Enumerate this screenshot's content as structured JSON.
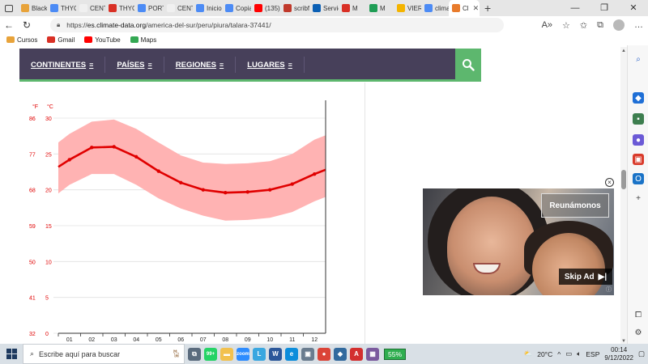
{
  "browser": {
    "tabs": [
      {
        "label": "Blackb",
        "color": "#e8a33a"
      },
      {
        "label": "THYCI",
        "color": "#4c8bf5"
      },
      {
        "label": "CENTF",
        "color": "#f0f0f0"
      },
      {
        "label": "THYC",
        "color": "#d93025"
      },
      {
        "label": "PORTA",
        "color": "#4c8bf5"
      },
      {
        "label": "CENTI",
        "color": "#f0f0f0"
      },
      {
        "label": "Inicio",
        "color": "#4c8bf5"
      },
      {
        "label": "Copia",
        "color": "#4c8bf5"
      },
      {
        "label": "(135) L",
        "color": "#ff0000"
      },
      {
        "label": "scribf",
        "color": "#c0392b"
      },
      {
        "label": "Servic",
        "color": "#0a5fb4"
      },
      {
        "label": "M",
        "color": "#d93025"
      },
      {
        "label": "M",
        "color": "#1f9d55"
      },
      {
        "label": "VIERN",
        "color": "#f4b400"
      },
      {
        "label": "clima",
        "color": "#4c8bf5"
      },
      {
        "label": "Cl",
        "color": "#e87b2c",
        "active": true
      }
    ],
    "new_tab": "+",
    "url_host": "es.climate-data.org",
    "url_path": "/america-del-sur/peru/piura/talara-37441/",
    "url_scheme": "https://",
    "bookmarks": [
      {
        "label": "Cursos",
        "color": "#e8a33a"
      },
      {
        "label": "Gmail",
        "color": "#d93025"
      },
      {
        "label": "YouTube",
        "color": "#ff0000"
      },
      {
        "label": "Maps",
        "color": "#34a853"
      }
    ]
  },
  "site_nav": {
    "items": [
      "CONTINENTES",
      "PAÍSES",
      "REGIONES",
      "LUGARES"
    ],
    "burger": "≡"
  },
  "chart_data": {
    "type": "line",
    "x": [
      "01",
      "02",
      "03",
      "04",
      "05",
      "06",
      "07",
      "08",
      "09",
      "10",
      "11",
      "12"
    ],
    "series": [
      {
        "values": [
          24.2,
          25.9,
          26.0,
          24.6,
          22.6,
          21.0,
          20.0,
          19.6,
          19.7,
          20.0,
          20.8,
          22.2
        ]
      }
    ],
    "band_upper": [
      27.8,
      29.5,
      29.8,
      28.5,
      26.6,
      24.8,
      23.8,
      23.6,
      23.7,
      24.0,
      25.0,
      27.0
    ],
    "band_lower": [
      20.7,
      22.2,
      22.2,
      20.7,
      18.8,
      17.4,
      16.4,
      15.7,
      15.8,
      16.1,
      16.9,
      18.4
    ],
    "y_left_unit": "°F",
    "y_right_unit": "°C",
    "y_ticks_f": [
      "86",
      "77",
      "68",
      "59",
      "50",
      "41",
      "32"
    ],
    "y_ticks_c": [
      "30",
      "25",
      "20",
      "15",
      "10",
      "5",
      "0"
    ],
    "ylim": [
      0,
      30
    ],
    "line_color": "#e00000",
    "band_color": "#ffb3b3",
    "grid": true
  },
  "ad": {
    "headline": "Reunámonos",
    "skip_label": "Skip Ad",
    "skip_icon": "▶|",
    "close": "×",
    "info": "ⓘ"
  },
  "taskbar": {
    "search_placeholder": "Escribe aquí para buscar",
    "battery": "55%",
    "temp": "20°C",
    "lang": "ESP",
    "time": "00:14",
    "date": "9/12/2022",
    "apps": [
      {
        "name": "task-view",
        "color": "#5a6b7d",
        "glyph": "⧉"
      },
      {
        "name": "whatsapp",
        "color": "#25d366",
        "glyph": "99+"
      },
      {
        "name": "file-explorer",
        "color": "#f2c14e",
        "glyph": "▬"
      },
      {
        "name": "zoom",
        "color": "#2d8cff",
        "glyph": "zoom"
      },
      {
        "name": "app-l",
        "color": "#3aa7e0",
        "glyph": "L"
      },
      {
        "name": "word",
        "color": "#2b579a",
        "glyph": "W"
      },
      {
        "name": "edge",
        "color": "#0c8ddb",
        "glyph": "e"
      },
      {
        "name": "remote",
        "color": "#6a7c8f",
        "glyph": "▣"
      },
      {
        "name": "chrome",
        "color": "#db4437",
        "glyph": "●"
      },
      {
        "name": "cube",
        "color": "#326a9e",
        "glyph": "◆"
      },
      {
        "name": "acrobat",
        "color": "#d32f2f",
        "glyph": "A"
      },
      {
        "name": "photos",
        "color": "#7b5a9e",
        "glyph": "▦"
      }
    ]
  }
}
